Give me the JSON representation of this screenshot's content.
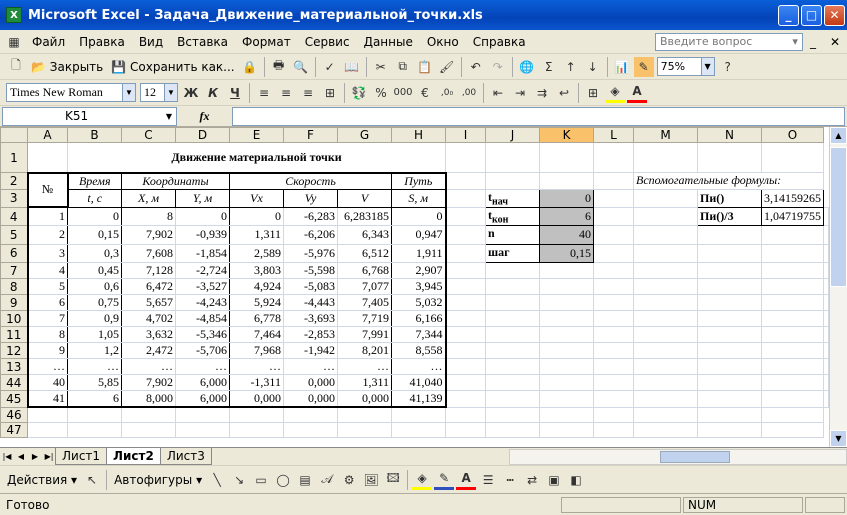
{
  "window": {
    "title": "Microsoft Excel - Задача_Движение_материальной_точки.xls",
    "min": "_",
    "max": "□",
    "close": "✕",
    "app_icon": "X"
  },
  "menu": {
    "items": [
      "Файл",
      "Правка",
      "Вид",
      "Вставка",
      "Формат",
      "Сервис",
      "Данные",
      "Окно",
      "Справка"
    ],
    "help_placeholder": "Введите вопрос",
    "doc_controls": [
      "_",
      "✕"
    ]
  },
  "toolbar1": {
    "open_label": "Закрыть",
    "save_label": "Сохранить как...",
    "zoom": "75%"
  },
  "toolbar2": {
    "font": "Times New Roman",
    "size": "12",
    "bold": "Ж",
    "italic": "К",
    "underline": "Ч",
    "percent": "%",
    "thousands": "000",
    "euro": "€",
    "dec_inc": ",0₀",
    "dec_dec": ",00"
  },
  "formula": {
    "cell": "K51",
    "fx": "fx",
    "value": ""
  },
  "columns": [
    "A",
    "B",
    "C",
    "D",
    "E",
    "F",
    "G",
    "H",
    "I",
    "J",
    "K",
    "L",
    "M",
    "N",
    "O"
  ],
  "selected_column": "K",
  "row_numbers": [
    "1",
    "2",
    "3",
    "4",
    "5",
    "6",
    "7",
    "8",
    "9",
    "10",
    "11",
    "12",
    "13",
    "44",
    "45",
    "46",
    "47"
  ],
  "table": {
    "title": "Движение материальной точки",
    "h_num": "№",
    "h_time": "Время",
    "h_coords": "Координаты",
    "h_speed": "Скорость",
    "h_path": "Путь",
    "h_t": "t, с",
    "h_x": "X, м",
    "h_y": "Y, м",
    "h_vx": "Vx",
    "h_vy": "Vy",
    "h_v": "V",
    "h_s": "S, м",
    "rows": [
      [
        "1",
        "0",
        "8",
        "0",
        "0",
        "-6,283",
        "6,283185",
        "0"
      ],
      [
        "2",
        "0,15",
        "7,902",
        "-0,939",
        "1,311",
        "-6,206",
        "6,343",
        "0,947"
      ],
      [
        "3",
        "0,3",
        "7,608",
        "-1,854",
        "2,589",
        "-5,976",
        "6,512",
        "1,911"
      ],
      [
        "4",
        "0,45",
        "7,128",
        "-2,724",
        "3,803",
        "-5,598",
        "6,768",
        "2,907"
      ],
      [
        "5",
        "0,6",
        "6,472",
        "-3,527",
        "4,924",
        "-5,083",
        "7,077",
        "3,945"
      ],
      [
        "6",
        "0,75",
        "5,657",
        "-4,243",
        "5,924",
        "-4,443",
        "7,405",
        "5,032"
      ],
      [
        "7",
        "0,9",
        "4,702",
        "-4,854",
        "6,778",
        "-3,693",
        "7,719",
        "6,166"
      ],
      [
        "8",
        "1,05",
        "3,632",
        "-5,346",
        "7,464",
        "-2,853",
        "7,991",
        "7,344"
      ],
      [
        "9",
        "1,2",
        "2,472",
        "-5,706",
        "7,968",
        "-1,942",
        "8,201",
        "8,558"
      ],
      [
        "…",
        "…",
        "…",
        "…",
        "…",
        "…",
        "…",
        "…"
      ],
      [
        "40",
        "5,85",
        "7,902",
        "6,000",
        "-1,311",
        "0,000",
        "1,311",
        "41,040"
      ],
      [
        "41",
        "6",
        "8,000",
        "6,000",
        "0,000",
        "0,000",
        "0,000",
        "41,139"
      ]
    ]
  },
  "params": [
    {
      "label": "t",
      "sub": "нач",
      "value": "0"
    },
    {
      "label": "t",
      "sub": "кон",
      "value": "6"
    },
    {
      "label": "n",
      "sub": "",
      "value": "40"
    },
    {
      "label": "шаг",
      "sub": "",
      "value": "0,15"
    }
  ],
  "helper": {
    "title": "Вспомогательные формулы:",
    "rows": [
      {
        "label": "Пи()",
        "value": "3,14159265"
      },
      {
        "label": "Пи()/3",
        "value": "1,04719755"
      }
    ]
  },
  "tabs": [
    "Лист1",
    "Лист2",
    "Лист3"
  ],
  "active_tab": "Лист2",
  "drawbar": {
    "actions": "Действия",
    "autoshapes": "Автофигуры"
  },
  "status": {
    "text": "Готово",
    "num": "NUM"
  }
}
